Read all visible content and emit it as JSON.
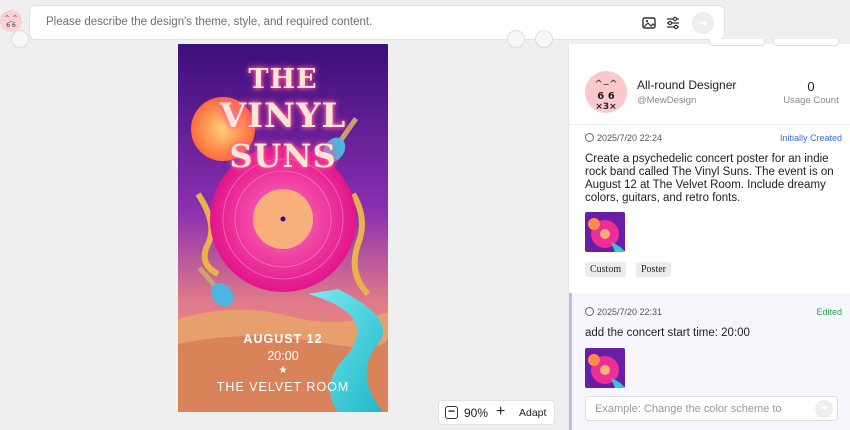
{
  "prompt": {
    "placeholder": "Please describe the design's theme, style, and required content.",
    "icons": [
      "image-upload-icon",
      "settings-sliders-icon",
      "send-arrow-icon"
    ]
  },
  "poster": {
    "title_line1": "THE",
    "title_line2": "VINYL",
    "title_line3": "SUNS",
    "date": "AUGUST 12",
    "time": "20:00",
    "star": "★",
    "venue": "THE VELVET ROOM"
  },
  "zoom": {
    "minus": "−",
    "value": "90%",
    "plus": "+",
    "adapt": "Adapt"
  },
  "profile": {
    "name": "All-round Designer",
    "handle": "@MewDesign",
    "usage_count": "0",
    "usage_label": "Usage Count"
  },
  "history": [
    {
      "time": "2025/7/20 22:24",
      "status": "Initially Created",
      "text_lines": [
        "Create a psychedelic concert poster for an indie",
        "rock band called The Vinyl Suns. The event is on",
        "August 12 at The Velvet Room. Include dreamy",
        "colors, guitars, and retro fonts."
      ],
      "tags": [
        "Custom",
        "Poster"
      ]
    },
    {
      "time": "2025/7/20 22:31",
      "status": "Edited",
      "text_lines": [
        "add the concert start time: 20:00"
      ]
    }
  ],
  "edit_input": {
    "placeholder": "Example: Change the color scheme to"
  },
  "colors": {
    "created_status": "#3a6fd8",
    "edited_status": "#2e9f57",
    "poster_pink": "#ff3d9a",
    "poster_purple": "#5a1aa8"
  }
}
